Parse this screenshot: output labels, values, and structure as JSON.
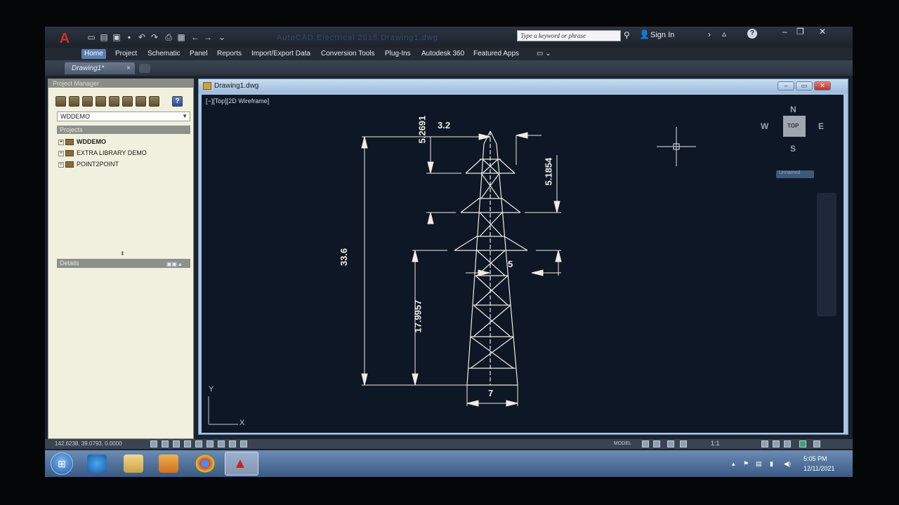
{
  "app": {
    "logo_glyph": "A",
    "doc_title_faint": "AutoCAD Electrical 2015   Drawing1.dwg",
    "search_placeholder": "Type a keyword or phrase",
    "sign_in": "Sign In",
    "help": "?"
  },
  "ribbon": {
    "tabs": [
      "Home",
      "Project",
      "Schematic",
      "Panel",
      "Reports",
      "Import/Export Data",
      "Conversion Tools",
      "Plug-Ins",
      "Autodesk 360",
      "Featured Apps"
    ],
    "active_tab": "Home"
  },
  "doc_tabs": {
    "current": "Drawing1*",
    "close": "×"
  },
  "project_manager": {
    "title": "Project Manager",
    "selected_project": "WDDEMO",
    "projects_header": "Projects",
    "projects": [
      {
        "name": "WDDEMO",
        "active": true
      },
      {
        "name": "EXTRA LIBRARY DEMO",
        "active": false
      },
      {
        "name": "POINT2POINT",
        "active": false
      }
    ],
    "details_header": "Details",
    "help_glyph": "?"
  },
  "drawing_window": {
    "title": "Drawing1.dwg",
    "viewport_label": "[−][Top][2D Wireframe]",
    "viewcube": {
      "north": "N",
      "south": "S",
      "east": "E",
      "west": "W",
      "top": "TOP",
      "ucs_name": "Unnamed"
    },
    "ucs_icon": {
      "y": "Y",
      "x": "X"
    },
    "dimensions": {
      "total_height": "33.6",
      "top_peak": "5.2691",
      "top_width": "3.2",
      "top_section": "5.1854",
      "lower_height": "17.9957",
      "arm_offset": "5",
      "base_width": "7"
    }
  },
  "statusbar": {
    "coords": "142.6238, 39.0793, 0.0000",
    "model": "MODEL",
    "scale": "1:1"
  },
  "taskbar": {
    "time": "5:05 PM",
    "date": "12/11/2021"
  },
  "colors": {
    "canvas_bg": "#0d1726",
    "drawing_lines": "#f0ece0",
    "autocad_red": "#d42a2a"
  }
}
